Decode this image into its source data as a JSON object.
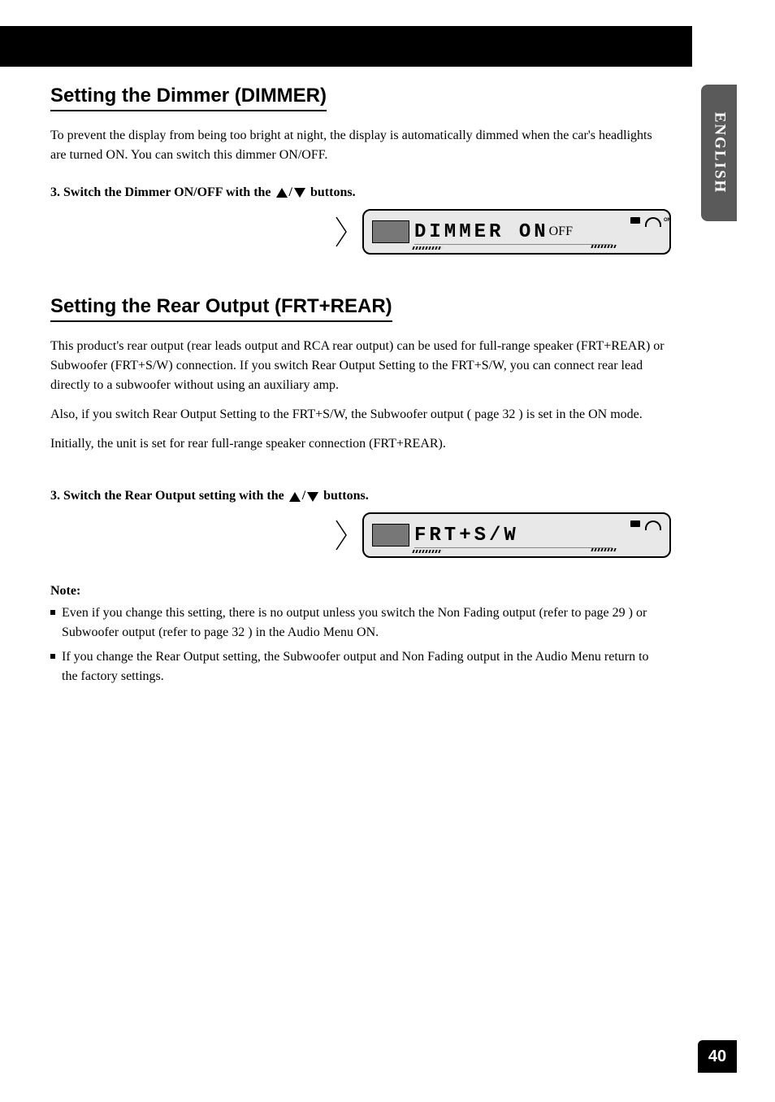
{
  "side_tab": "ENGLISH",
  "page_number": "40",
  "section1": {
    "heading": "Setting the Dimmer (DIMMER)",
    "para1": "To prevent the display from being too bright at night, the display is automatically dimmed when the car's headlights are turned ON. You can switch this dimmer ON/OFF.",
    "step_num": "3.",
    "step_prefix": "Switch the Dimmer ON/OFF with the ",
    "step_suffix": " buttons.",
    "display_text": "DIMMER ON",
    "icon_on": "ON",
    "icon_off": "OFF"
  },
  "section2": {
    "heading": "Setting the Rear Output (FRT+REAR)",
    "para1": "This product's rear output (rear leads output and RCA rear output) can be used for full-range speaker (FRT+REAR) or Subwoofer (FRT+S/W) connection. If you switch Rear Output Setting to the FRT+S/W, you can connect rear lead directly to a subwoofer without using an auxiliary amp.",
    "para2_prefix": "Also, if you switch Rear Output Setting to the FRT+S/W, the Subwoofer output (",
    "para2_link": "page 32",
    "para2_suffix": ") is set in the ON mode.",
    "para3": "Initially, the unit is set for rear full-range speaker connection (FRT+REAR).",
    "step_num": "3.",
    "step_prefix": "Switch the Rear Output setting with the ",
    "step_suffix": " buttons.",
    "display_text": "FRT+S/W",
    "note_title": "Note:",
    "note1_prefix": "Even if you change this setting, there is no output unless you switch the Non Fading output (refer to ",
    "note1_link1": "page 29",
    "note1_mid": ") or Subwoofer output (refer to ",
    "note1_link2": "page 32",
    "note1_suffix": ") in the Audio Menu ON.",
    "note2": "If you change the Rear Output setting, the Subwoofer output and Non Fading output in the Audio Menu return to the factory settings."
  }
}
